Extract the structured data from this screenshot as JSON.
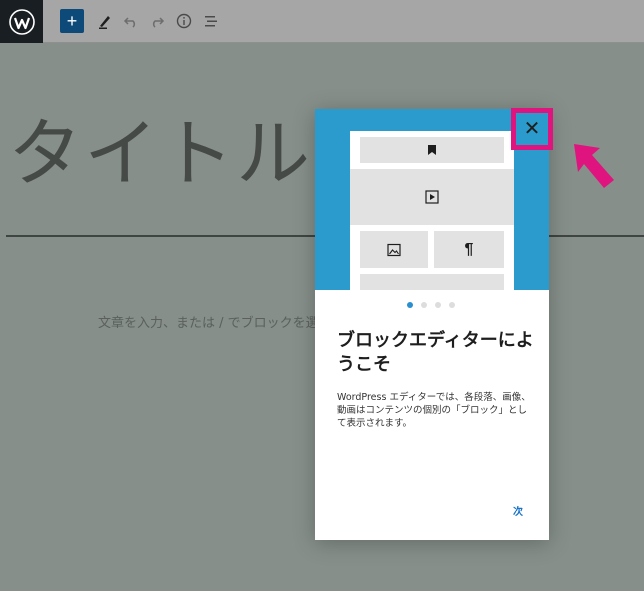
{
  "toolbar": {
    "add_label": "+",
    "icons": [
      "wordpress-logo-icon",
      "add-block-icon",
      "edit-pen-icon",
      "undo-icon",
      "redo-icon",
      "info-icon",
      "list-view-icon"
    ]
  },
  "editor": {
    "title_placeholder": "タイトルを追加",
    "body_placeholder": "文章を入力、または / でブロックを選択"
  },
  "guide": {
    "close_label": "✕",
    "heading": "ブロックエディターにようこそ",
    "description": "WordPress エディターでは、各段落、画像、動画はコンテンツの個別の「ブロック」として表示されます。",
    "next_label": "次",
    "current_page": 1,
    "total_pages": 4,
    "paragraph_symbol": "¶"
  },
  "colors": {
    "hero": "#2a9bcc",
    "highlight": "#e0147f",
    "accent": "#1a73c8",
    "toolbar_button": "#0d4a7a"
  }
}
